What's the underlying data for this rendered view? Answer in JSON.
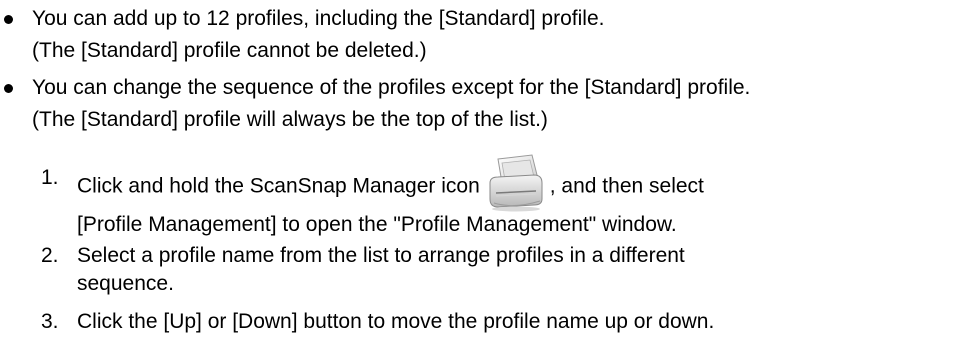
{
  "bullets": [
    {
      "line1": "You can add up to 12 profiles, including the [Standard] profile.",
      "line2": "(The [Standard] profile cannot be deleted.)"
    },
    {
      "line1": "You can change the sequence of the profiles except for the [Standard] profile.",
      "line2": "(The [Standard] profile will always be the top of the list.)"
    }
  ],
  "steps": [
    {
      "number": "1.",
      "text_before_icon": "Click and hold the ScanSnap Manager icon",
      "icon": "scansnap-manager-icon",
      "text_after_icon": ", and then select",
      "line2": "[Profile Management] to open the \"Profile Management\" window."
    },
    {
      "number": "2.",
      "line1": "Select a profile name from the list to arrange profiles in a different",
      "line2": "sequence."
    },
    {
      "number": "3.",
      "line1": "Click the [Up] or [Down] button to move the profile name up or down."
    }
  ]
}
